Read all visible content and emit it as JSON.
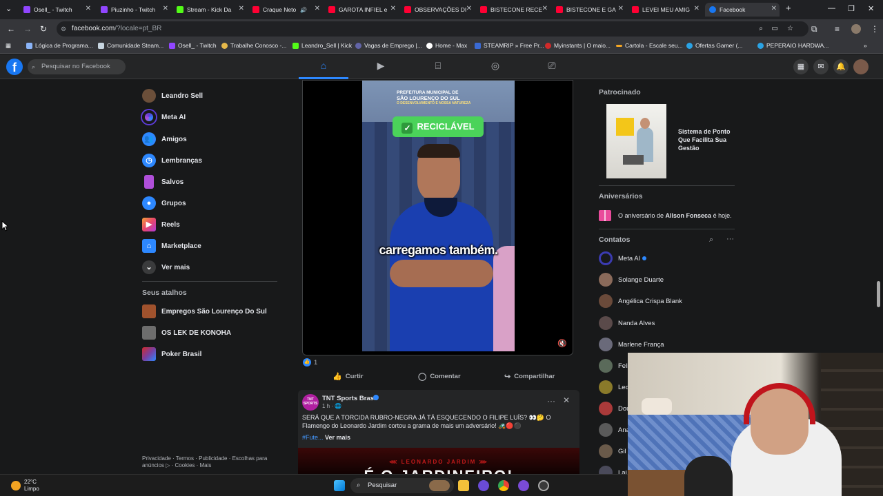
{
  "browser": {
    "tabs": [
      {
        "label": "Osell_ - Twitch",
        "color": "#9146ff"
      },
      {
        "label": "Piuzinho - Twitch",
        "color": "#9146ff"
      },
      {
        "label": "Stream - Kick Da",
        "color": "#53fc18"
      },
      {
        "label": "Craque Neto",
        "color": "#ff0033"
      },
      {
        "label": "GAROTA INFIEL e",
        "color": "#ff0033"
      },
      {
        "label": "OBSERVAÇÕES DI",
        "color": "#ff0033"
      },
      {
        "label": "BISTECONE RECE",
        "color": "#ff0033"
      },
      {
        "label": "BISTECONE E GA",
        "color": "#ff0033"
      },
      {
        "label": "LEVEI MEU AMIG",
        "color": "#ff0033"
      },
      {
        "label": "Facebook",
        "color": "#1877f2"
      }
    ],
    "url_host": "facebook.com",
    "url_path": "/?locale=pt_BR",
    "bookmarks": [
      "Lógica de Programa...",
      "Comunidade Steam...",
      "Osell_ - Twitch",
      "Trabalhe Conosco -...",
      "Leandro_Sell | Kick",
      "Vagas de Emprego |...",
      "Home - Max",
      "STEAMRIP » Free Pr...",
      "Myinstants | O maio...",
      "Cartola - Escale seu...",
      "Ofertas Gamer (...",
      "PEPERAIO HARDWA..."
    ]
  },
  "header": {
    "search_placeholder": "Pesquisar no Facebook"
  },
  "sidebar": {
    "items": [
      {
        "label": "Leandro Sell",
        "icon": "avatar",
        "color": "#6b4f3a"
      },
      {
        "label": "Meta AI",
        "icon": "meta-ai-icon",
        "color": "#5b3bd6"
      },
      {
        "label": "Amigos",
        "icon": "friends-icon",
        "color": "#2d88ff"
      },
      {
        "label": "Lembranças",
        "icon": "memories-icon",
        "color": "#2d88ff"
      },
      {
        "label": "Salvos",
        "icon": "bookmark-icon",
        "color": "#b04fd9"
      },
      {
        "label": "Grupos",
        "icon": "groups-icon",
        "color": "#2d88ff"
      },
      {
        "label": "Reels",
        "icon": "reels-icon",
        "color": "#e8456c"
      },
      {
        "label": "Marketplace",
        "icon": "marketplace-icon",
        "color": "#2d88ff"
      },
      {
        "label": "Ver mais",
        "icon": "chevron-down-icon",
        "color": "#3a3b3c"
      }
    ],
    "shortcuts_title": "Seus atalhos",
    "shortcuts": [
      {
        "label": "Empregos São Lourenço Do Sul",
        "color": "#a0522d"
      },
      {
        "label": "OS LEK DE KONOHA",
        "color": "#6d6d6d"
      },
      {
        "label": "Poker Brasil",
        "color": "#7a3fa0"
      }
    ],
    "footer": "Privacidade · Termos · Publicidade · Escolhas para anúncios ▷ · Cookies · Mais"
  },
  "feed": {
    "video": {
      "header_line1": "PREFEITURA MUNICIPAL DE",
      "header_line2": "SÃO LOURENÇO DO SUL",
      "header_line3": "O DESENVOLVIMENTO É NOSSA NATUREZA",
      "badge": "RECICLÁVEL",
      "caption": "carregamos também."
    },
    "likes_count": "1",
    "actions": {
      "like": "Curtir",
      "comment": "Comentar",
      "share": "Compartilhar"
    },
    "post2": {
      "page": "TNT Sports Brasil",
      "avatar_text": "TNT SPORTS",
      "time": "1 h · 🌐",
      "text": "SERÁ QUE A TORCIDA RUBRO-NEGRA JÁ TÁ ESQUECENDO O FILIPE LUÍS? 👀🤔 O Flamengo do Leonardo Jardim cortou a grama de mais um adversário! 🚜🔴⚫",
      "hashtag": "#Fute...",
      "see_more": "Ver mais",
      "image_text1": "⋘ LEONARDO JARDIM ⋙",
      "image_text2": "É O JARDINEIRO!"
    }
  },
  "right": {
    "sponsored_title": "Patrocinado",
    "ad_text": "Sistema de Ponto Que Facilita Sua Gestão",
    "birthdays_title": "Aniversários",
    "birthday_pre": "O aniversário de ",
    "birthday_name": "Allson Fonseca",
    "birthday_post": " é hoje.",
    "contacts_title": "Contatos",
    "contacts": [
      {
        "name": "Meta AI",
        "color": "#3b3bb0"
      },
      {
        "name": "Solange Duarte",
        "color": "#8a6a5a"
      },
      {
        "name": "Angélica Crispa Blank",
        "color": "#6a4a3a"
      },
      {
        "name": "Nanda Alves",
        "color": "#5a4a4a"
      },
      {
        "name": "Marlene França",
        "color": "#6a6a7a"
      },
      {
        "name": "Feli",
        "color": "#5a6a5a"
      },
      {
        "name": "Leo",
        "color": "#8a7a2a"
      },
      {
        "name": "Dou",
        "color": "#aa3a3a"
      },
      {
        "name": "Ana",
        "color": "#5a5a5a"
      },
      {
        "name": "Gil",
        "color": "#6a5a4a"
      },
      {
        "name": "Lai",
        "color": "#4a4a5a"
      }
    ]
  },
  "taskbar": {
    "temp": "22°C",
    "condition": "Limpo",
    "search": "Pesquisar"
  }
}
